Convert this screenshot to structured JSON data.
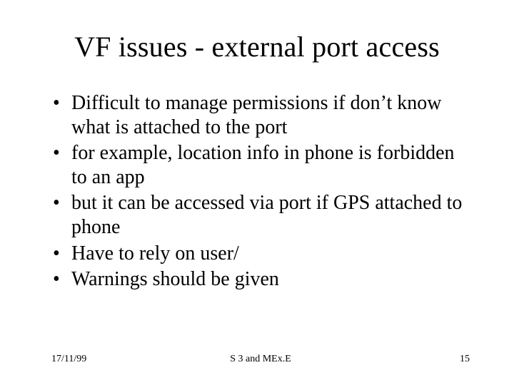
{
  "title": "VF issues - external port access",
  "bullets": [
    "Difficult to manage permissions if don’t know what is attached to the port",
    "for example, location info in phone is forbidden to an app",
    "but it can be accessed via port if GPS attached to phone",
    "Have to  rely on user/",
    "Warnings should be given"
  ],
  "footer": {
    "date": "17/11/99",
    "center": "S 3 and MEx.E",
    "page": "15"
  }
}
